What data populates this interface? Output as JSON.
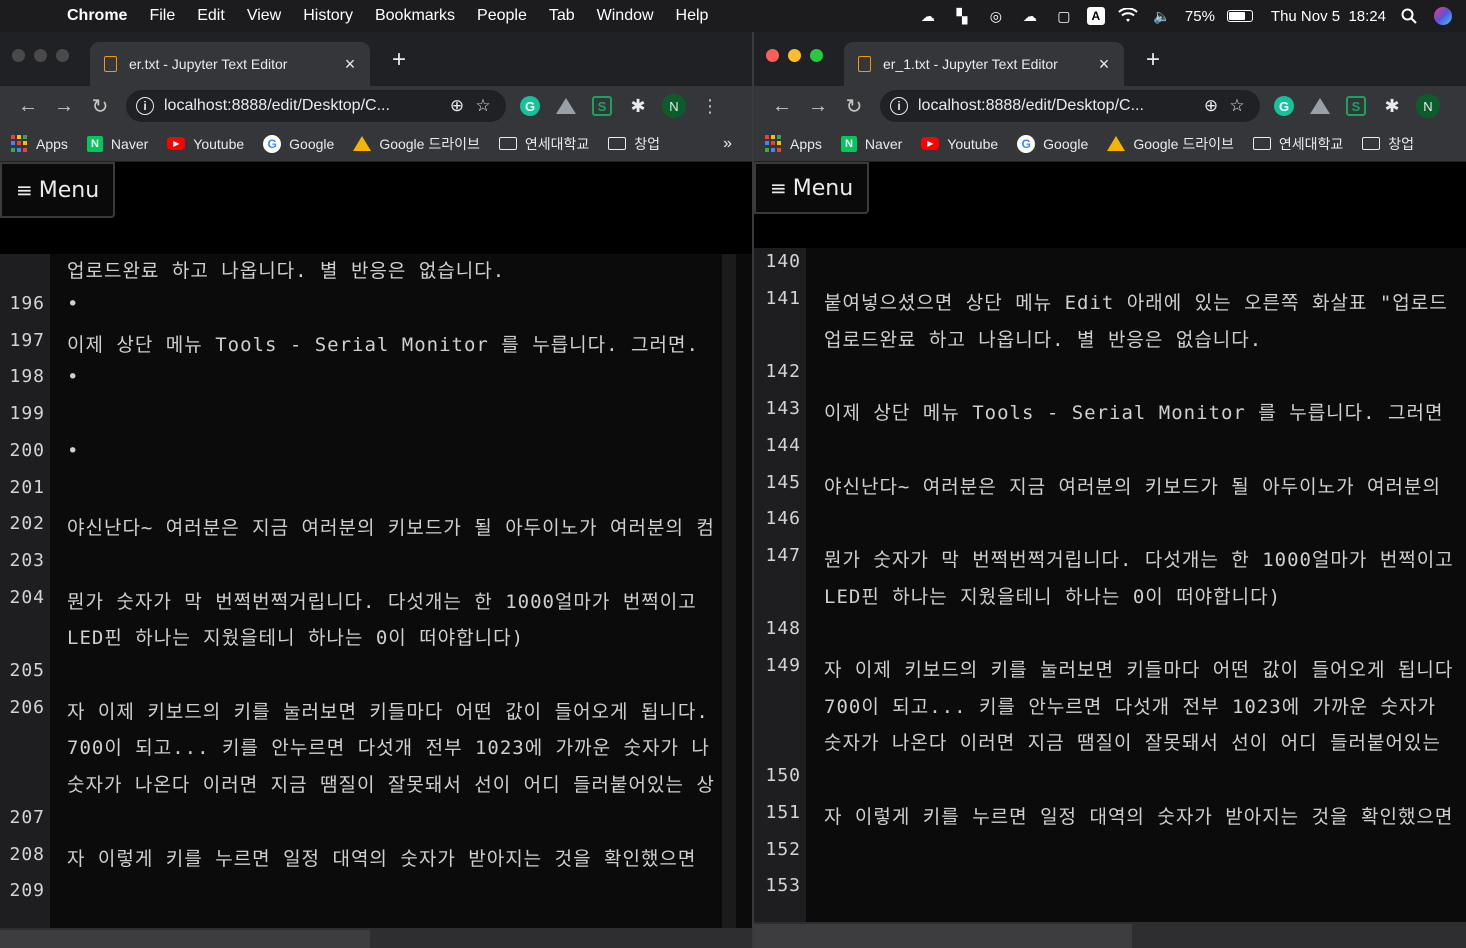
{
  "menubar": {
    "apple": "",
    "items": [
      "Chrome",
      "File",
      "Edit",
      "View",
      "History",
      "Bookmarks",
      "People",
      "Tab",
      "Window",
      "Help"
    ],
    "battery": "75%",
    "battery_level": 0.75,
    "datetime": "Thu Nov 5  18:24"
  },
  "left": {
    "tab_title": "er.txt - Jupyter Text Editor",
    "url": "localhost:8888/edit/Desktop/C...",
    "bookmarks": [
      "Apps",
      "Naver",
      "Youtube",
      "Google",
      "Google 드라이브",
      "연세대학교",
      "창업"
    ],
    "more": "»",
    "menu_label": "Menu",
    "partial_top_line": "업로드완료 하고 나옵니다. 별 반응은 없습니다.",
    "lines": [
      {
        "n": "196",
        "text": [
          "•"
        ]
      },
      {
        "n": "197",
        "text": [
          "이제 상단 메뉴 Tools - Serial Monitor 를 누릅니다. 그러면."
        ]
      },
      {
        "n": "198",
        "text": [
          "•"
        ]
      },
      {
        "n": "199",
        "text": [
          ""
        ]
      },
      {
        "n": "200",
        "text": [
          "•"
        ]
      },
      {
        "n": "201",
        "text": [
          ""
        ]
      },
      {
        "n": "202",
        "text": [
          "야신난다~ 여러분은 지금 여러분의 키보드가 될 아두이노가 여러분의 컴"
        ]
      },
      {
        "n": "203",
        "text": [
          ""
        ]
      },
      {
        "n": "204",
        "text": [
          "뭔가 숫자가 막 번쩍번쩍거립니다. 다섯개는 한 1000얼마가 번쩍이고",
          "LED핀 하나는 지웠을테니 하나는 0이 떠야합니다)"
        ]
      },
      {
        "n": "205",
        "text": [
          ""
        ]
      },
      {
        "n": "206",
        "text": [
          "자 이제 키보드의 키를 눌러보면 키들마다 어떤 값이 들어오게 됩니다.",
          "700이 되고... 키를 안누르면 다섯개 전부 1023에 가까운 숫자가 나",
          "숫자가 나온다 이러면 지금 땜질이 잘못돼서 선이 어디 들러붙어있는 상"
        ]
      },
      {
        "n": "207",
        "text": [
          ""
        ]
      },
      {
        "n": "208",
        "text": [
          "자 이렇게 키를 누르면 일정 대역의 숫자가 받아지는 것을 확인했으면"
        ]
      },
      {
        "n": "209",
        "text": [
          ""
        ]
      }
    ]
  },
  "right": {
    "tab_title": "er_1.txt - Jupyter Text Editor",
    "url": "localhost:8888/edit/Desktop/C...",
    "bookmarks": [
      "Apps",
      "Naver",
      "Youtube",
      "Google",
      "Google 드라이브",
      "연세대학교",
      "창업"
    ],
    "menu_label": "Menu",
    "partial_top_num": "140",
    "lines": [
      {
        "n": "141",
        "text": [
          "붙여넣으셨으면 상단 메뉴  Edit 아래에 있는 오른쪽 화살표 \"업로드",
          "업로드완료 하고 나옵니다. 별 반응은 없습니다."
        ]
      },
      {
        "n": "142",
        "text": [
          ""
        ]
      },
      {
        "n": "143",
        "text": [
          "이제 상단 메뉴 Tools - Serial Monitor 를 누릅니다. 그러면"
        ]
      },
      {
        "n": "144",
        "text": [
          ""
        ]
      },
      {
        "n": "145",
        "text": [
          "야신난다~ 여러분은 지금 여러분의 키보드가 될 아두이노가 여러분의"
        ]
      },
      {
        "n": "146",
        "text": [
          ""
        ]
      },
      {
        "n": "147",
        "text": [
          "뭔가 숫자가 막 번쩍번쩍거립니다. 다섯개는 한 1000얼마가 번쩍이고",
          "LED핀 하나는 지웠을테니 하나는 0이 떠야합니다)"
        ]
      },
      {
        "n": "148",
        "text": [
          ""
        ]
      },
      {
        "n": "149",
        "text": [
          "자 이제 키보드의 키를 눌러보면 키들마다 어떤 값이 들어오게 됩니다",
          "700이 되고... 키를 안누르면 다섯개 전부 1023에 가까운 숫자가",
          "숫자가 나온다 이러면 지금 땜질이 잘못돼서 선이 어디 들러붙어있는"
        ]
      },
      {
        "n": "150",
        "text": [
          ""
        ]
      },
      {
        "n": "151",
        "text": [
          "자 이렇게 키를 누르면 일정 대역의 숫자가 받아지는 것을 확인했으면"
        ]
      },
      {
        "n": "152",
        "text": [
          ""
        ]
      },
      {
        "n": "153",
        "text": [
          ""
        ]
      }
    ]
  },
  "colors": {
    "light_red": "#ff5f57",
    "light_yellow": "#febc2e",
    "light_green": "#28c840",
    "light_inactive": "#4a4a4c",
    "editor_bg": "#0c0b0c",
    "gutter_bg": "#1e1e20"
  }
}
